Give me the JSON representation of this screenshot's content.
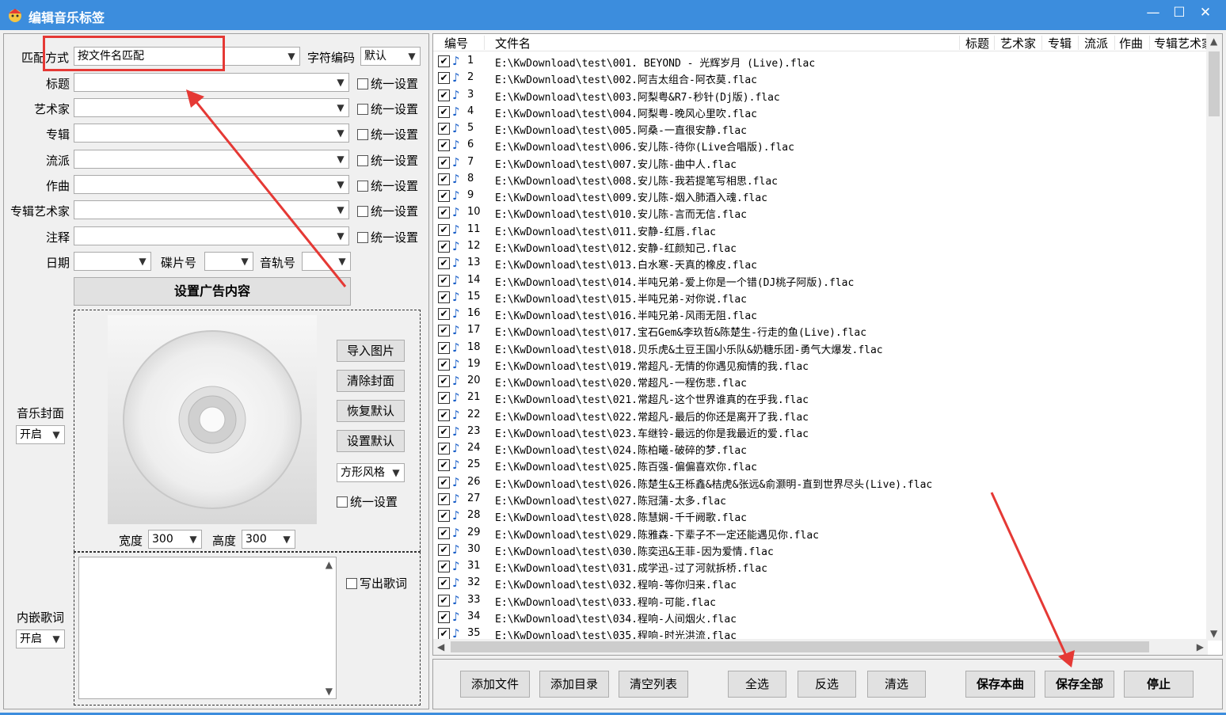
{
  "window": {
    "title": "编辑音乐标签",
    "min": "—",
    "max": "☐",
    "close": "✕"
  },
  "left": {
    "match_label": "匹配方式",
    "match_value": "按文件名匹配",
    "encoding_label": "字符编码",
    "encoding_value": "默认",
    "fields": [
      {
        "label": "标题",
        "check": "统一设置"
      },
      {
        "label": "艺术家",
        "check": "统一设置"
      },
      {
        "label": "专辑",
        "check": "统一设置"
      },
      {
        "label": "流派",
        "check": "统一设置"
      },
      {
        "label": "作曲",
        "check": "统一设置"
      },
      {
        "label": "专辑艺术家",
        "check": "统一设置"
      },
      {
        "label": "注释",
        "check": "统一设置"
      }
    ],
    "date_label": "日期",
    "disc_label": "碟片号",
    "track_label": "音轨号",
    "ad_button": "设置广告内容",
    "cover": {
      "label": "音乐封面",
      "mode": "开启",
      "import": "导入图片",
      "clear": "清除封面",
      "restore": "恢复默认",
      "setdefault": "设置默认",
      "style": "方形风格",
      "unify": "统一设置",
      "width_label": "宽度",
      "width_value": "300",
      "height_label": "高度",
      "height_value": "300"
    },
    "lyrics": {
      "label": "内嵌歌词",
      "mode": "开启",
      "write": "写出歌词"
    }
  },
  "list": {
    "headers": {
      "num": "编号",
      "file": "文件名",
      "title": "标题",
      "artist": "艺术家",
      "album": "专辑",
      "genre": "流派",
      "composer": "作曲",
      "albumartist": "专辑艺术家"
    },
    "rows": [
      {
        "n": "1",
        "f": "E:\\KwDownload\\test\\001. BEYOND - 光辉岁月 (Live).flac"
      },
      {
        "n": "2",
        "f": "E:\\KwDownload\\test\\002.阿吉太组合-阿衣莫.flac"
      },
      {
        "n": "3",
        "f": "E:\\KwDownload\\test\\003.阿梨粤&R7-秒针(Dj版).flac"
      },
      {
        "n": "4",
        "f": "E:\\KwDownload\\test\\004.阿梨粤-晚风心里吹.flac"
      },
      {
        "n": "5",
        "f": "E:\\KwDownload\\test\\005.阿桑-一直很安静.flac"
      },
      {
        "n": "6",
        "f": "E:\\KwDownload\\test\\006.安儿陈-待你(Live合唱版).flac"
      },
      {
        "n": "7",
        "f": "E:\\KwDownload\\test\\007.安儿陈-曲中人.flac"
      },
      {
        "n": "8",
        "f": "E:\\KwDownload\\test\\008.安儿陈-我若提笔写相思.flac"
      },
      {
        "n": "9",
        "f": "E:\\KwDownload\\test\\009.安儿陈-烟入肺酒入魂.flac"
      },
      {
        "n": "10",
        "f": "E:\\KwDownload\\test\\010.安儿陈-言而无信.flac"
      },
      {
        "n": "11",
        "f": "E:\\KwDownload\\test\\011.安静-红唇.flac"
      },
      {
        "n": "12",
        "f": "E:\\KwDownload\\test\\012.安静-红颜知己.flac"
      },
      {
        "n": "13",
        "f": "E:\\KwDownload\\test\\013.白水寒-天真的橡皮.flac"
      },
      {
        "n": "14",
        "f": "E:\\KwDownload\\test\\014.半吨兄弟-爱上你是一个错(DJ桃子阿版).flac"
      },
      {
        "n": "15",
        "f": "E:\\KwDownload\\test\\015.半吨兄弟-对你说.flac"
      },
      {
        "n": "16",
        "f": "E:\\KwDownload\\test\\016.半吨兄弟-风雨无阻.flac"
      },
      {
        "n": "17",
        "f": "E:\\KwDownload\\test\\017.宝石Gem&李玖哲&陈楚生-行走的鱼(Live).flac"
      },
      {
        "n": "18",
        "f": "E:\\KwDownload\\test\\018.贝乐虎&土豆王国小乐队&奶糖乐团-勇气大爆发.flac"
      },
      {
        "n": "19",
        "f": "E:\\KwDownload\\test\\019.常超凡-无情的你遇见痴情的我.flac"
      },
      {
        "n": "20",
        "f": "E:\\KwDownload\\test\\020.常超凡-一程伤悲.flac"
      },
      {
        "n": "21",
        "f": "E:\\KwDownload\\test\\021.常超凡-这个世界谁真的在乎我.flac"
      },
      {
        "n": "22",
        "f": "E:\\KwDownload\\test\\022.常超凡-最后的你还是离开了我.flac"
      },
      {
        "n": "23",
        "f": "E:\\KwDownload\\test\\023.车继铃-最远的你是我最近的爱.flac"
      },
      {
        "n": "24",
        "f": "E:\\KwDownload\\test\\024.陈柏曦-破碎的梦.flac"
      },
      {
        "n": "25",
        "f": "E:\\KwDownload\\test\\025.陈百强-偏偏喜欢你.flac"
      },
      {
        "n": "26",
        "f": "E:\\KwDownload\\test\\026.陈楚生&王栎鑫&桔虎&张远&俞灏明-直到世界尽头(Live).flac"
      },
      {
        "n": "27",
        "f": "E:\\KwDownload\\test\\027.陈冠蒲-太多.flac"
      },
      {
        "n": "28",
        "f": "E:\\KwDownload\\test\\028.陈慧娴-千千阙歌.flac"
      },
      {
        "n": "29",
        "f": "E:\\KwDownload\\test\\029.陈雅森-下辈子不一定还能遇见你.flac"
      },
      {
        "n": "30",
        "f": "E:\\KwDownload\\test\\030.陈奕迅&王菲-因为爱情.flac"
      },
      {
        "n": "31",
        "f": "E:\\KwDownload\\test\\031.成学迅-过了河就拆桥.flac"
      },
      {
        "n": "32",
        "f": "E:\\KwDownload\\test\\032.程响-等你归来.flac"
      },
      {
        "n": "33",
        "f": "E:\\KwDownload\\test\\033.程响-可能.flac"
      },
      {
        "n": "34",
        "f": "E:\\KwDownload\\test\\034.程响-人间烟火.flac"
      },
      {
        "n": "35",
        "f": "E:\\KwDownload\\test\\035.程响-时光洪流.flac"
      }
    ],
    "check_mark": "✔",
    "note_glyph": "♪"
  },
  "bottom": {
    "add_file": "添加文件",
    "add_dir": "添加目录",
    "clear_list": "清空列表",
    "select_all": "全选",
    "invert": "反选",
    "deselect": "清选",
    "save_one": "保存本曲",
    "save_all": "保存全部",
    "stop": "停止"
  },
  "colors": {
    "titlebar": "#3c8ddd",
    "annotation": "#e53935",
    "note": "#1a5fc8"
  }
}
